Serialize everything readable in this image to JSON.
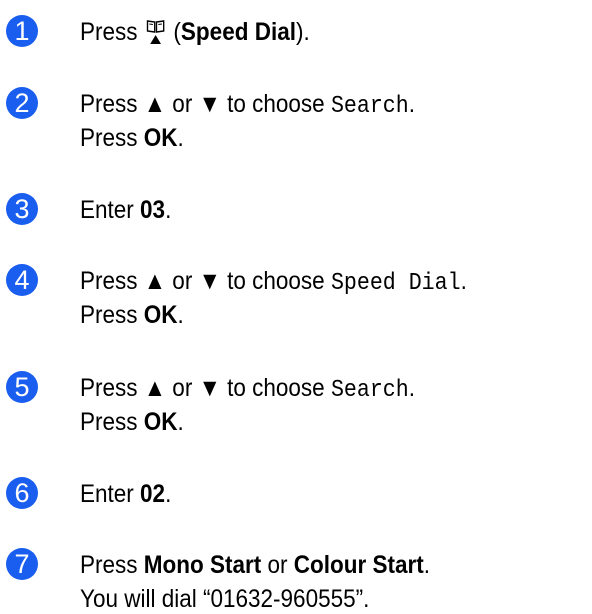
{
  "accent_color": "#1a5ef0",
  "steps": [
    {
      "number": "1",
      "line1": {
        "a": "Press",
        "icon": "speed-dial-book-icon",
        "b": "(",
        "bold": "Speed Dial",
        "c": ")."
      }
    },
    {
      "number": "2",
      "line1": {
        "a": "Press",
        "up": "▲",
        "or": "or",
        "down": "▼",
        "mid": "to choose",
        "mono": "Search",
        "end": "."
      },
      "line2": {
        "a": "Press",
        "bold": "OK",
        "end": "."
      }
    },
    {
      "number": "3",
      "line1": {
        "a": "Enter",
        "bold": "03",
        "end": "."
      }
    },
    {
      "number": "4",
      "line1": {
        "a": "Press",
        "up": "▲",
        "or": "or",
        "down": "▼",
        "mid": "to choose",
        "mono": "Speed Dial",
        "end": "."
      },
      "line2": {
        "a": "Press",
        "bold": "OK",
        "end": "."
      }
    },
    {
      "number": "5",
      "line1": {
        "a": "Press",
        "up": "▲",
        "or": "or",
        "down": "▼",
        "mid": "to choose",
        "mono": "Search",
        "end": "."
      },
      "line2": {
        "a": "Press",
        "bold": "OK",
        "end": "."
      }
    },
    {
      "number": "6",
      "line1": {
        "a": "Enter",
        "bold": "02",
        "end": "."
      }
    },
    {
      "number": "7",
      "line1": {
        "a": "Press",
        "bold1": "Mono Start",
        "or": "or",
        "bold2": "Colour Start",
        "end": "."
      },
      "line2": {
        "text": "You will dial “01632-960555”."
      }
    }
  ]
}
